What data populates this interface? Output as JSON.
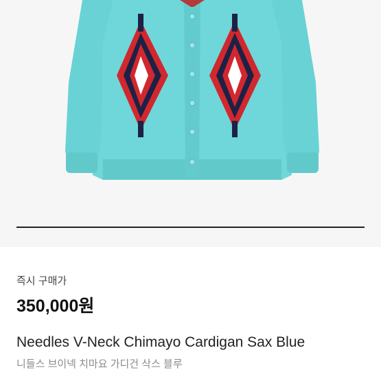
{
  "product": {
    "image_alt": "Needles V-Neck Chimayo Cardigan Sax Blue",
    "image_index": 1,
    "image_count": 1,
    "instant_buy_label": "즉시 구매가",
    "price": "350,000원",
    "name": "Needles V-Neck Chimayo Cardigan Sax Blue",
    "name_korean": "니들스 브이넥 치마요 가디건 삭스 블루"
  },
  "colors": {
    "cardigan": "#6fd7d9",
    "background": "#f6f6f6",
    "pattern_red": "#d0282e",
    "pattern_navy": "#1d2145",
    "pattern_white": "#ffffff"
  }
}
